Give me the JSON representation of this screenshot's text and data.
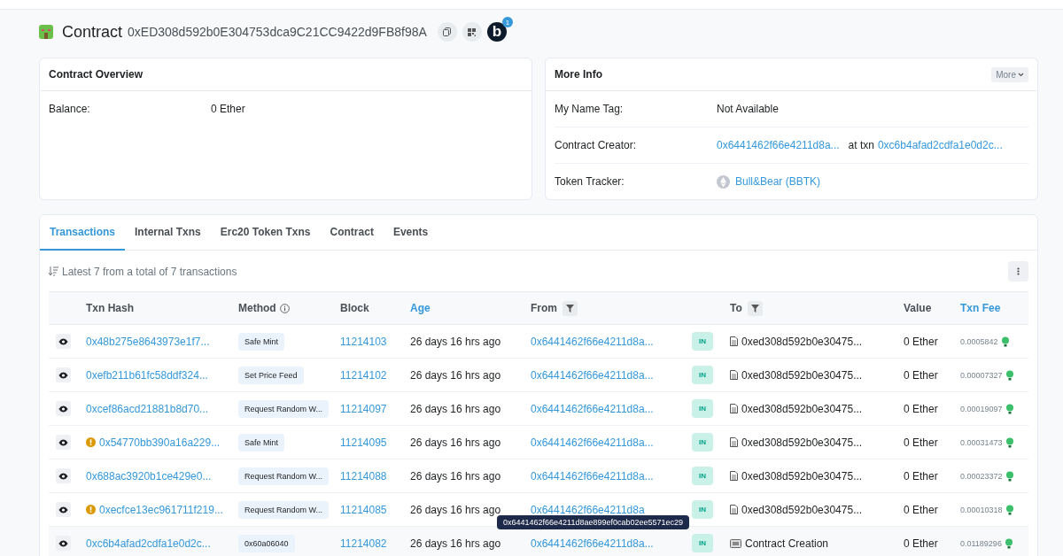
{
  "header": {
    "title": "Contract",
    "address": "0xED308d592b0E304753dca9C21CC9422d9FB8f98A",
    "badge_count": "1",
    "badge_letter": "b"
  },
  "overview": {
    "title": "Contract Overview",
    "rows": [
      {
        "label": "Balance:",
        "value": "0 Ether"
      }
    ]
  },
  "more_info": {
    "title": "More Info",
    "more_button": "More",
    "name_tag": {
      "label": "My Name Tag:",
      "value": "Not Available"
    },
    "creator": {
      "label": "Contract Creator:",
      "address": "0x6441462f66e4211d8a...",
      "at_txn": "at txn",
      "txn": "0xc6b4afad2cdfa1e0d2c..."
    },
    "token_tracker": {
      "label": "Token Tracker:",
      "value": "Bull&Bear (BBTK)"
    }
  },
  "tabs": [
    {
      "label": "Transactions",
      "selected": true
    },
    {
      "label": "Internal Txns",
      "selected": false
    },
    {
      "label": "Erc20 Token Txns",
      "selected": false
    },
    {
      "label": "Contract",
      "selected": false
    },
    {
      "label": "Events",
      "selected": false
    }
  ],
  "summary": "Latest 7 from a total of 7 transactions",
  "table": {
    "columns": [
      {
        "kind": "plain"
      },
      {
        "label": "Txn Hash",
        "kind": "plain"
      },
      {
        "label": "Method",
        "kind": "info"
      },
      {
        "label": "Block",
        "kind": "plain"
      },
      {
        "label": "Age",
        "kind": "link"
      },
      {
        "label": "From",
        "kind": "filter"
      },
      {
        "kind": "plain"
      },
      {
        "label": "To",
        "kind": "filter"
      },
      {
        "label": "Value",
        "kind": "plain"
      },
      {
        "label": "Txn Fee",
        "kind": "link"
      }
    ],
    "rows": [
      {
        "hash": "0x48b275e8643973e1f7...",
        "error": false,
        "method": "Safe Mint",
        "block": "11214103",
        "age": "26 days 16 hrs ago",
        "from": "0x6441462f66e4211d8a...",
        "direction": "IN",
        "to": "0xed308d592b0e30475...",
        "kind": "contract",
        "value": "0 Ether",
        "fee": "0.0005842",
        "hovered": false
      },
      {
        "hash": "0xefb211b61fc58ddf324...",
        "error": false,
        "method": "Set Price Feed",
        "block": "11214102",
        "age": "26 days 16 hrs ago",
        "from": "0x6441462f66e4211d8a...",
        "direction": "IN",
        "to": "0xed308d592b0e30475...",
        "kind": "contract",
        "value": "0 Ether",
        "fee": "0.00007327",
        "hovered": false
      },
      {
        "hash": "0xcef86acd21881b8d70...",
        "error": false,
        "method": "Request Random W...",
        "block": "11214097",
        "age": "26 days 16 hrs ago",
        "from": "0x6441462f66e4211d8a...",
        "direction": "IN",
        "to": "0xed308d592b0e30475...",
        "kind": "contract",
        "value": "0 Ether",
        "fee": "0.00019097",
        "hovered": false
      },
      {
        "hash": "0x54770bb390a16a229...",
        "error": true,
        "method": "Safe Mint",
        "block": "11214095",
        "age": "26 days 16 hrs ago",
        "from": "0x6441462f66e4211d8a...",
        "direction": "IN",
        "to": "0xed308d592b0e30475...",
        "kind": "contract",
        "value": "0 Ether",
        "fee": "0.00031473",
        "hovered": false
      },
      {
        "hash": "0x688ac3920b1ce429e0...",
        "error": false,
        "method": "Request Random W...",
        "block": "11214088",
        "age": "26 days 16 hrs ago",
        "from": "0x6441462f66e4211d8a...",
        "direction": "IN",
        "to": "0xed308d592b0e30475...",
        "kind": "contract",
        "value": "0 Ether",
        "fee": "0.00023372",
        "hovered": false
      },
      {
        "hash": "0xecfce13ec961711f219...",
        "error": true,
        "method": "Request Random W...",
        "block": "11214085",
        "age": "26 days 16 hrs ago",
        "from": "0x6441462f66e4211d8a",
        "direction": "IN",
        "to": "0xed308d592b0e30475...",
        "kind": "contract",
        "value": "0 Ether",
        "fee": "0.00010318",
        "hovered": false
      },
      {
        "hash": "0xc6b4afad2cdfa1e0d2c...",
        "error": false,
        "method": "0x60a06040",
        "block": "11214082",
        "age": "26 days 16 hrs ago",
        "from": "0x6441462f66e4211d8a...",
        "direction": "IN",
        "to": "Contract Creation",
        "kind": "creation",
        "value": "0 Ether",
        "fee": "0.01189296",
        "hovered": true,
        "tooltip": "0x6441462f66e4211d8ae899ef0cab02ee5571ec29"
      }
    ]
  }
}
